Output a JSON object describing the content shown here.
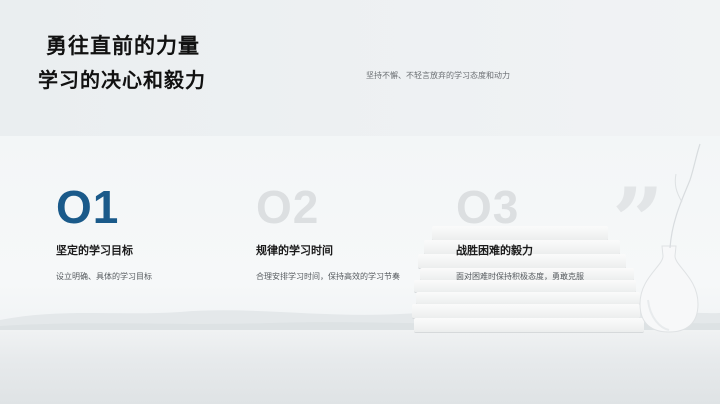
{
  "header": {
    "title_line1": "勇往直前的力量",
    "title_line2": "学习的决心和毅力",
    "subtitle": "坚持不懈、不轻言放弃的学习态度和动力"
  },
  "items": [
    {
      "number": "O1",
      "title": "坚定的学习目标",
      "desc": "设立明确、具体的学习目标"
    },
    {
      "number": "O2",
      "title": "规律的学习时间",
      "desc": "合理安排学习时间，保持高效的学习节奏"
    },
    {
      "number": "O3",
      "title": "战胜困难的毅力",
      "desc": "面对困难时保持积极态度，勇敢克服"
    }
  ],
  "decor": {
    "quote_mark": "”",
    "quote_icon": "quote-icon",
    "accent_color": "#1a5a8a"
  }
}
